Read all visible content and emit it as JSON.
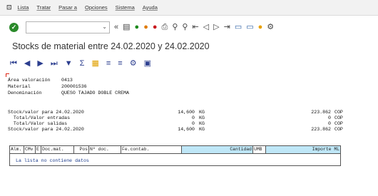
{
  "menubar": {
    "items": [
      "Lista",
      "Tratar",
      "Pasar a",
      "Opciones",
      "Sistema",
      "Ayuda"
    ]
  },
  "toolbar": {
    "command_field_value": ""
  },
  "page_title": "Stocks de material entre 24.02.2020 y 24.02.2020",
  "header": {
    "area_label": "Área valoración",
    "area_value": "0413",
    "material_label": "Material",
    "material_value": "200001536",
    "denom_label": "Denominación",
    "denom_value": "QUESO TAJADO DOBLE CREMA"
  },
  "stock_rows": [
    {
      "label": "Stock/valor para 24.02.2020",
      "qty": "14,600",
      "unit": "KG",
      "value": "223.862",
      "currency": "COP"
    },
    {
      "label": "  Total/Valor entradas",
      "qty": "0",
      "unit": "KG",
      "value": "0",
      "currency": "COP"
    },
    {
      "label": "  Total/Valor salidas",
      "qty": "0",
      "unit": "KG",
      "value": "0",
      "currency": "COP"
    },
    {
      "label": "Stock/valor para 24.02.2020",
      "qty": "14,600",
      "unit": "KG",
      "value": "223.862",
      "currency": "COP"
    }
  ],
  "list_columns": [
    "Alm.",
    "CMv",
    "E",
    "Doc.mat.",
    "Pos",
    "Nº doc.",
    "Fe.contab.",
    "Cantidad",
    "UMB",
    "Importe ML"
  ],
  "empty_message": "La lista no contiene datos"
}
